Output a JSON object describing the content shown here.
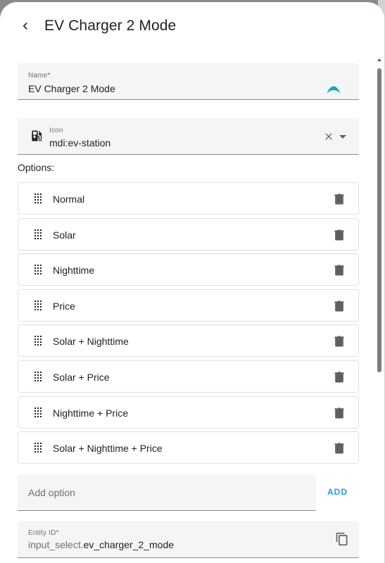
{
  "header": {
    "title": "EV Charger 2 Mode"
  },
  "name_field": {
    "label": "Name*",
    "value": "EV Charger 2 Mode"
  },
  "icon_field": {
    "label": "Icon",
    "value": "mdi:ev-station"
  },
  "options": {
    "label": "Options:",
    "items": [
      {
        "label": "Normal"
      },
      {
        "label": "Solar"
      },
      {
        "label": "Nighttime"
      },
      {
        "label": "Price"
      },
      {
        "label": "Solar + Nighttime"
      },
      {
        "label": "Solar + Price"
      },
      {
        "label": "Nighttime + Price"
      },
      {
        "label": "Solar + Nighttime + Price"
      }
    ]
  },
  "add_option": {
    "placeholder": "Add option",
    "button_label": "ADD"
  },
  "entity_id": {
    "label": "Entity ID*",
    "prefix": "input_select.",
    "value": "ev_charger_2_mode"
  },
  "colors": {
    "accent": "#1f9ee3",
    "teal": "#03a9c4",
    "field_bg": "#f5f5f5"
  }
}
